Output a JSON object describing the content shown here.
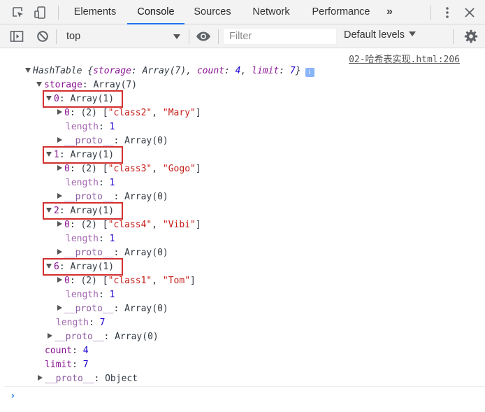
{
  "tabs": [
    {
      "label": "Elements",
      "active": false
    },
    {
      "label": "Console",
      "active": true
    },
    {
      "label": "Sources",
      "active": false
    },
    {
      "label": "Network",
      "active": false
    },
    {
      "label": "Performance",
      "active": false
    }
  ],
  "more_tabs_glyph": "»",
  "toolbar": {
    "context": "top",
    "filter_placeholder": "Filter",
    "levels": "Default levels"
  },
  "console": {
    "source": "02-哈希表实现.html:206",
    "summary": {
      "class": "HashTable",
      "open": " {",
      "storage_key": "storage",
      "storage_val": "Array(7)",
      "count_key": "count",
      "count_val": "4",
      "limit_key": "limit",
      "limit_val": "7",
      "close": "}"
    },
    "storage_line": {
      "key": "storage",
      "value": "Array(7)"
    },
    "buckets": [
      {
        "index": "0",
        "value": "Array(1)",
        "item_index": "0",
        "item_len": "(2)",
        "items": [
          "\"class2\"",
          "\"Mary\""
        ]
      },
      {
        "index": "1",
        "value": "Array(1)",
        "item_index": "0",
        "item_len": "(2)",
        "items": [
          "\"class3\"",
          "\"Gogo\""
        ]
      },
      {
        "index": "2",
        "value": "Array(1)",
        "item_index": "0",
        "item_len": "(2)",
        "items": [
          "\"class4\"",
          "\"Vibi\""
        ]
      },
      {
        "index": "6",
        "value": "Array(1)",
        "item_index": "0",
        "item_len": "(2)",
        "items": [
          "\"class1\"",
          "\"Tom\""
        ]
      }
    ],
    "length_key": "length",
    "inner_length": "1",
    "proto_key": "__proto__",
    "array_proto": "Array(0)",
    "storage_length": "7",
    "count_key": "count",
    "count_val": "4",
    "limit_key": "limit",
    "limit_val": "7",
    "object_proto": "Object",
    "info_glyph": "i",
    "prompt": "›"
  },
  "colors": {
    "accent": "#1a73e8",
    "highlight": "#d32f2f",
    "key": "#881391",
    "string": "#c41a16",
    "number": "#1c00cf"
  }
}
